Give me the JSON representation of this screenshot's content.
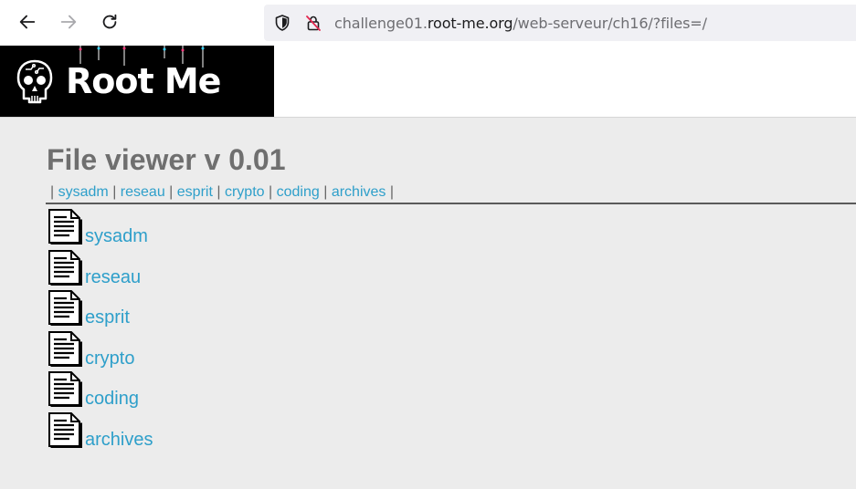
{
  "browser": {
    "url_prefix": "challenge01.",
    "url_domain": "root-me.org",
    "url_path": "/web-serveur/ch16/?files=/"
  },
  "banner": {
    "logo_text": "Root Me"
  },
  "page": {
    "title": "File viewer v 0.01",
    "menu": [
      {
        "label": "sysadm"
      },
      {
        "label": "reseau"
      },
      {
        "label": "esprit"
      },
      {
        "label": "crypto"
      },
      {
        "label": "coding"
      },
      {
        "label": "archives"
      }
    ],
    "files": [
      {
        "label": "sysadm"
      },
      {
        "label": "reseau"
      },
      {
        "label": "esprit"
      },
      {
        "label": "crypto"
      },
      {
        "label": "coding"
      },
      {
        "label": "archives"
      }
    ]
  },
  "colors": {
    "link": "#2e9fca",
    "title": "#6f6f6f",
    "background": "#ececec"
  }
}
